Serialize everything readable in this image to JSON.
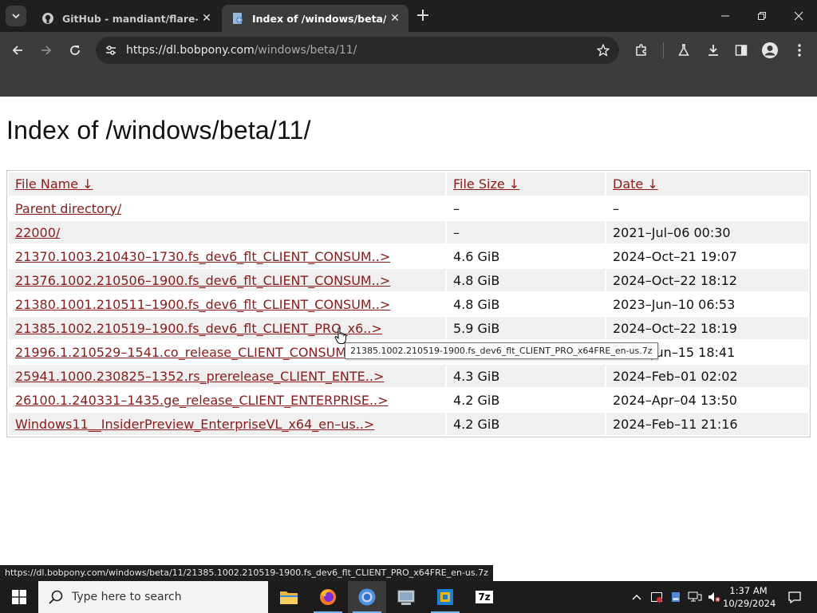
{
  "browser": {
    "tabs": [
      {
        "title": "GitHub - mandiant/flare-vm: A",
        "active": false
      },
      {
        "title": "Index of /windows/beta/11/",
        "active": true
      }
    ],
    "url_host": "https://dl.bobpony.com",
    "url_path": "/windows/beta/11/",
    "colors": {
      "tabbar": "#1f1f1f",
      "toolbar": "#3c3c3c",
      "omnibox": "#282828"
    }
  },
  "page": {
    "heading": "Index of /windows/beta/11/",
    "columns": {
      "name": "File Name  ↓",
      "size": "File Size  ↓",
      "date": "Date  ↓"
    },
    "rows": [
      {
        "name": "Parent directory/",
        "size": "–",
        "date": "–"
      },
      {
        "name": "22000/",
        "size": "–",
        "date": "2021–Jul–06 00:30"
      },
      {
        "name": "21370.1003.210430–1730.fs_dev6_flt_CLIENT_CONSUM..>",
        "size": "4.6 GiB",
        "date": "2024–Oct–21 19:07"
      },
      {
        "name": "21376.1002.210506–1900.fs_dev6_flt_CLIENT_CONSUM..>",
        "size": "4.8 GiB",
        "date": "2024–Oct–22 18:12"
      },
      {
        "name": "21380.1001.210511–1900.fs_dev6_flt_CLIENT_CONSUM..>",
        "size": "4.8 GiB",
        "date": "2023–Jun–10 06:53"
      },
      {
        "name": "21385.1002.210519–1900.fs_dev6_flt_CLIENT_PRO_x6..>",
        "size": "5.9 GiB",
        "date": "2024–Oct–22 18:19"
      },
      {
        "name": "21996.1.210529–1541.co_release_CLIENT_CONSUMER..>",
        "size": "",
        "date": "2021–Jun–15 18:41"
      },
      {
        "name": "25941.1000.230825–1352.rs_prerelease_CLIENT_ENTE..>",
        "size": "4.3 GiB",
        "date": "2024–Feb–01 02:02"
      },
      {
        "name": "26100.1.240331–1435.ge_release_CLIENT_ENTERPRISE..>",
        "size": "4.2 GiB",
        "date": "2024–Apr–04 13:50"
      },
      {
        "name": "Windows11__InsiderPreview_EnterpriseVL_x64_en–us..>",
        "size": "4.2 GiB",
        "date": "2024–Feb–11 21:16"
      }
    ],
    "link_color": "#8b1a1a",
    "tooltip": "21385.1002.210519-1900.fs_dev6_flt_CLIENT_PRO_x64FRE_en-us.7z",
    "status_url": "https://dl.bobpony.com/windows/beta/11/21385.1002.210519-1900.fs_dev6_flt_CLIENT_PRO_x64FRE_en-us.7z"
  },
  "taskbar": {
    "search_placeholder": "Type here to search",
    "time": "1:37 AM",
    "date": "10/29/2024",
    "apps": [
      "file-explorer-icon",
      "firefox-icon",
      "chrome-icon",
      "system-tool-icon",
      "virtualbox-icon",
      "7zip-icon"
    ],
    "sevenzip_label": "7z"
  }
}
